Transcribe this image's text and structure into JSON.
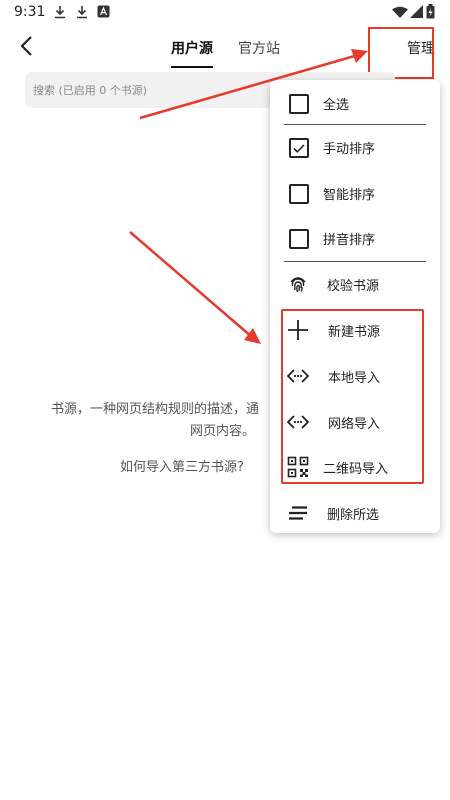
{
  "status_bar": {
    "time": "9:31"
  },
  "header": {
    "tabs": [
      {
        "label": "用户源"
      },
      {
        "label": "官方站"
      }
    ],
    "manage_label": "管理"
  },
  "search": {
    "placeholder": "搜索 (已启用 0 个书源)"
  },
  "empty": {
    "line1": "书源，一种网页结构规则的描述，通",
    "line2": "网页内容。",
    "link": "如何导入第三方书源?"
  },
  "menu": {
    "items": [
      {
        "label": "全选",
        "checked": false
      },
      {
        "label": "手动排序",
        "checked": true
      },
      {
        "label": "智能排序",
        "checked": false
      },
      {
        "label": "拼音排序",
        "checked": false
      },
      {
        "label": "校验书源",
        "icon": "fingerprint-icon"
      },
      {
        "label": "新建书源",
        "icon": "plus-icon"
      },
      {
        "label": "本地导入",
        "icon": "code-icon"
      },
      {
        "label": "网络导入",
        "icon": "code-icon"
      },
      {
        "label": "二维码导入",
        "icon": "qr-code-icon"
      },
      {
        "label": "删除所选",
        "icon": "lines-icon"
      }
    ]
  },
  "colors": {
    "highlight": "#e53a2c"
  }
}
